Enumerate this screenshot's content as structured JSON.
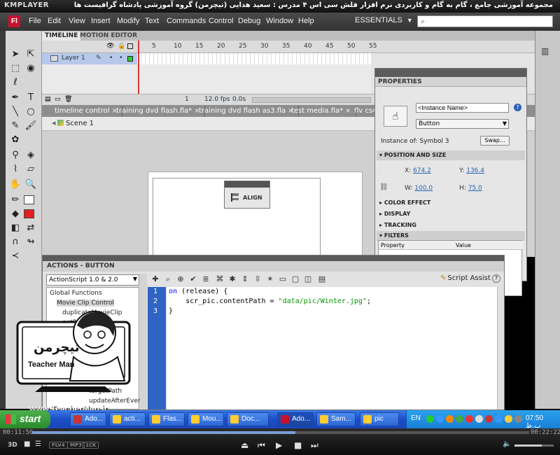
{
  "player": {
    "logo": "KMPLAYER",
    "caption": "مجموعه آموزشی جامع ، گام به گام و کاربردی نرم افزار فلش سی اس ۴ مدرس : سعید هدایی (تیچرمن) گروه آموزشی پادشاه گرافیست ها",
    "time_elapsed": "00:11:50",
    "time_total": "00:22:22",
    "progress_fraction": 0.53,
    "volume_fraction": 0.7,
    "badges": [
      "3D",
      "FLV4",
      "MP3",
      "1CK"
    ]
  },
  "flash": {
    "logo": "Fl",
    "menu": [
      "File",
      "Edit",
      "View",
      "Insert",
      "Modify",
      "Text",
      "Commands",
      "Control",
      "Debug",
      "Window",
      "Help"
    ],
    "workspace": "ESSENTIALS",
    "search_placeholder": ""
  },
  "timeline": {
    "tabs": [
      "TIMELINE",
      "MOTION EDITOR"
    ],
    "frame_numbers": [
      "5",
      "10",
      "15",
      "20",
      "25",
      "30",
      "35",
      "40",
      "45",
      "50",
      "55",
      "60",
      "65",
      "70",
      "75",
      "80",
      "85",
      "9"
    ],
    "layer_name": "Layer 1",
    "frame": "1",
    "fps": "12.0 fps",
    "time": "0.0s"
  },
  "doc_tabs": [
    "timeline control",
    "training dvd flash.fla*",
    "training dvd flash as3.fla",
    "test media.fla*",
    "flv cs4"
  ],
  "scene": "Scene 1",
  "align_panel": {
    "label": "ALIGN"
  },
  "properties": {
    "title": "PROPERTIES",
    "instance_name": "<Instance Name>",
    "symbol_type": "Button",
    "instance_of": "Instance of:  Symbol 3",
    "swap_label": "Swap...",
    "position_section": "POSITION AND SIZE",
    "x_label": "X:",
    "x_value": "674.2",
    "y_label": "Y:",
    "y_value": "136.4",
    "w_label": "W:",
    "w_value": "100.0",
    "h_label": "H:",
    "h_value": "75.0",
    "sections": [
      "COLOR EFFECT",
      "DISPLAY",
      "TRACKING",
      "FILTERS"
    ],
    "filter_cols": [
      "Property",
      "Value"
    ]
  },
  "actions": {
    "title": "ACTIONS - BUTTON",
    "version": "ActionScript 1.0 & 2.0",
    "script_assist": "Script Assist",
    "tree": [
      "Global Functions",
      "Movie Clip Control",
      "duplicateMovieClip",
      "getProperty",
      "startDrag",
      "stopDrag",
      "targetPath",
      "updateAfterEvent"
    ],
    "line_numbers": [
      "1",
      "2",
      "3"
    ],
    "code": {
      "l1_kw": "on",
      "l1_rest": " (release) {",
      "l2_pre": "    scr_pic.contentPath = ",
      "l2_str": "\"data/pic/Winter.jpg\"",
      "l2_post": ";",
      "l3": "}"
    }
  },
  "badge": {
    "brand_fa": "تیچرمن",
    "brand_en": "Teacher Man",
    "site": "www.TeacherMan.ir"
  },
  "taskbar": {
    "start": "start",
    "tasks": [
      "Ado...",
      "acti...",
      "Flas...",
      "Mou...",
      "Doc...",
      "Ado...",
      "Sam...",
      "pic"
    ],
    "lang": "EN",
    "clock": "07:50 ب.ظ"
  }
}
